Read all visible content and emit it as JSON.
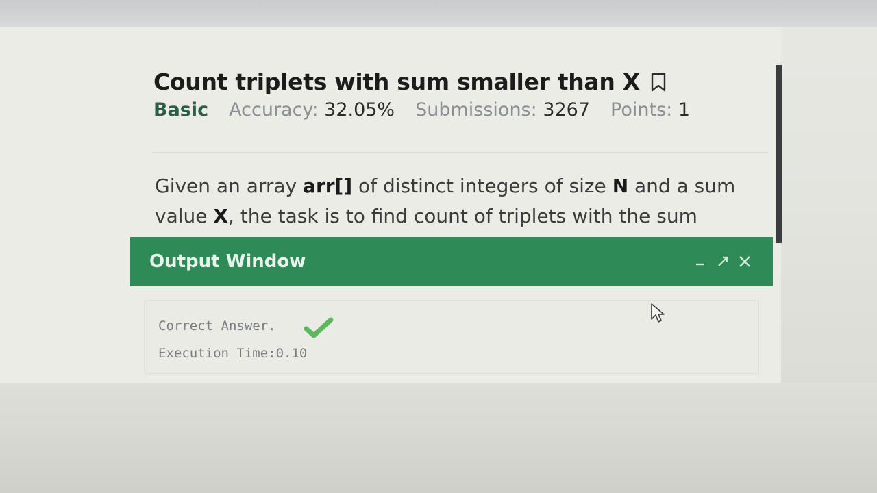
{
  "problem": {
    "title": "Count triplets with sum smaller than X",
    "difficulty": "Basic",
    "accuracy_label": "Accuracy:",
    "accuracy_value": "32.05%",
    "submissions_label": "Submissions:",
    "submissions_value": "3267",
    "points_label": "Points:",
    "points_value": "1",
    "description": {
      "p1": "Given an array ",
      "arr": "arr[]",
      "p2": " of distinct integers of size ",
      "n": "N",
      "p3": " and a sum value ",
      "x": "X",
      "p4": ", the task is to find count of triplets with the sum"
    }
  },
  "output_window": {
    "title": "Output Window",
    "result_line": "Correct Answer.",
    "time_line": "Execution Time:0.10"
  },
  "colors": {
    "accent_green": "#2e8b57",
    "difficulty_green": "#2a5e45",
    "check_green": "#5cb85c"
  },
  "icons": {
    "bookmark": "bookmark-icon",
    "minimize": "minimize-icon",
    "maximize": "expand-icon",
    "close": "close-icon",
    "check": "check-icon",
    "cursor": "pointer-cursor-icon"
  }
}
